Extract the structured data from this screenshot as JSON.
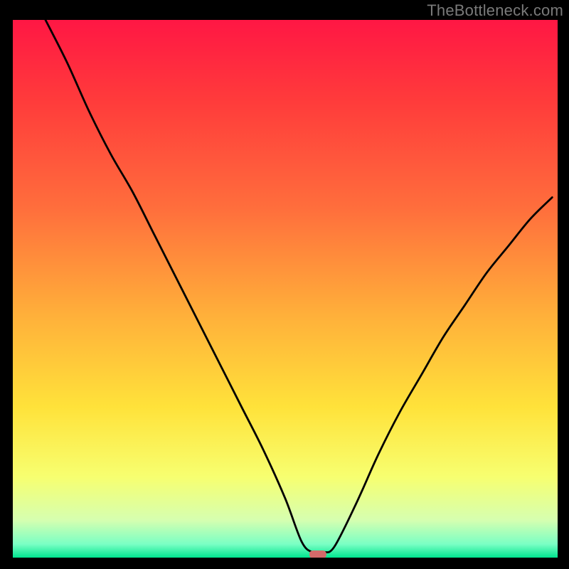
{
  "watermark": "TheBottleneck.com",
  "chart_data": {
    "type": "line",
    "title": "",
    "xlabel": "",
    "ylabel": "",
    "xlim": [
      0,
      100
    ],
    "ylim": [
      0,
      100
    ],
    "grid": false,
    "series": [
      {
        "name": "curve",
        "x": [
          6,
          10,
          14,
          18,
          22,
          26,
          30,
          34,
          38,
          42,
          46,
          50,
          53,
          55,
          57,
          59,
          63,
          67,
          71,
          75,
          79,
          83,
          87,
          91,
          95,
          99
        ],
        "values": [
          100,
          92,
          83,
          75,
          68,
          60,
          52,
          44,
          36,
          28,
          20,
          11,
          3,
          1,
          1,
          2,
          10,
          19,
          27,
          34,
          41,
          47,
          53,
          58,
          63,
          67
        ]
      }
    ],
    "marker": {
      "x": 56,
      "y": 0.6
    },
    "gradient_stops": [
      {
        "offset": 0.0,
        "color": "#ff1744"
      },
      {
        "offset": 0.15,
        "color": "#ff3b3b"
      },
      {
        "offset": 0.35,
        "color": "#ff6e3c"
      },
      {
        "offset": 0.55,
        "color": "#ffb03a"
      },
      {
        "offset": 0.72,
        "color": "#ffe23a"
      },
      {
        "offset": 0.85,
        "color": "#f7ff70"
      },
      {
        "offset": 0.93,
        "color": "#d6ffb0"
      },
      {
        "offset": 0.975,
        "color": "#7affc4"
      },
      {
        "offset": 1.0,
        "color": "#00e58f"
      }
    ]
  }
}
